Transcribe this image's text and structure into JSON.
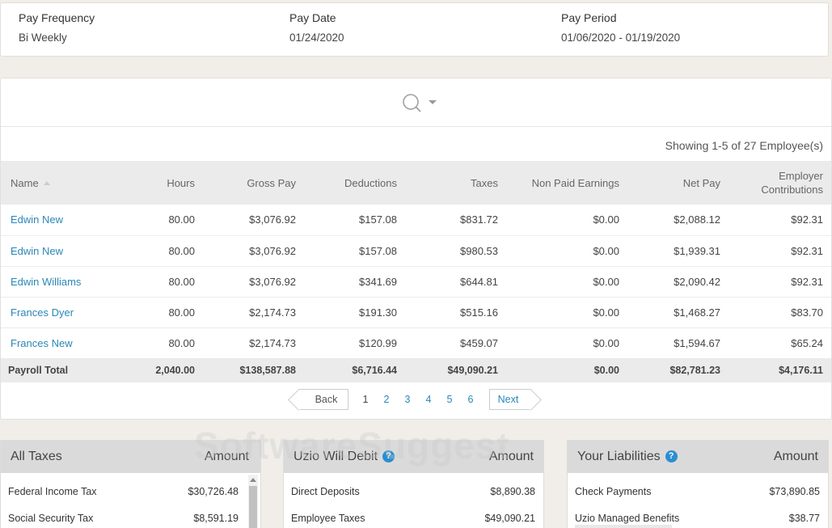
{
  "pay_info": {
    "frequency_label": "Pay Frequency",
    "frequency_value": "Bi Weekly",
    "date_label": "Pay Date",
    "date_value": "01/24/2020",
    "period_label": "Pay Period",
    "period_value": "01/06/2020 - 01/19/2020"
  },
  "search": {
    "icon": "search-icon",
    "dropdown_icon": "caret-down-icon"
  },
  "showing_text": "Showing 1-5 of 27 Employee(s)",
  "table": {
    "headers": {
      "name": "Name",
      "hours": "Hours",
      "gross": "Gross Pay",
      "deductions": "Deductions",
      "taxes": "Taxes",
      "non_paid": "Non Paid Earnings",
      "net": "Net Pay",
      "employer_line1": "Employer",
      "employer_line2": "Contributions"
    },
    "rows": [
      {
        "name": "Edwin New",
        "hours": "80.00",
        "gross": "$3,076.92",
        "deductions": "$157.08",
        "taxes": "$831.72",
        "non_paid": "$0.00",
        "net": "$2,088.12",
        "employer": "$92.31"
      },
      {
        "name": "Edwin New",
        "hours": "80.00",
        "gross": "$3,076.92",
        "deductions": "$157.08",
        "taxes": "$980.53",
        "non_paid": "$0.00",
        "net": "$1,939.31",
        "employer": "$92.31"
      },
      {
        "name": "Edwin Williams",
        "hours": "80.00",
        "gross": "$3,076.92",
        "deductions": "$341.69",
        "taxes": "$644.81",
        "non_paid": "$0.00",
        "net": "$2,090.42",
        "employer": "$92.31"
      },
      {
        "name": "Frances Dyer",
        "hours": "80.00",
        "gross": "$2,174.73",
        "deductions": "$191.30",
        "taxes": "$515.16",
        "non_paid": "$0.00",
        "net": "$1,468.27",
        "employer": "$83.70"
      },
      {
        "name": "Frances New",
        "hours": "80.00",
        "gross": "$2,174.73",
        "deductions": "$120.99",
        "taxes": "$459.07",
        "non_paid": "$0.00",
        "net": "$1,594.67",
        "employer": "$65.24"
      }
    ],
    "total": {
      "name": "Payroll Total",
      "hours": "2,040.00",
      "gross": "$138,587.88",
      "deductions": "$6,716.44",
      "taxes": "$49,090.21",
      "non_paid": "$0.00",
      "net": "$82,781.23",
      "employer": "$4,176.11"
    }
  },
  "pagination": {
    "back": "Back",
    "next": "Next",
    "pages": [
      "1",
      "2",
      "3",
      "4",
      "5",
      "6"
    ],
    "current": "1"
  },
  "panels": {
    "all_taxes": {
      "title": "All Taxes",
      "amount_label": "Amount",
      "rows": [
        {
          "label": "Federal Income Tax",
          "value": "$30,726.48"
        },
        {
          "label": "Social Security Tax",
          "value": "$8,591.19"
        }
      ]
    },
    "uzio_debit": {
      "title": "Uzio Will Debit",
      "amount_label": "Amount",
      "help_icon": "help-icon",
      "rows": [
        {
          "label": "Direct Deposits",
          "value": "$8,890.38"
        },
        {
          "label": "Employee Taxes",
          "value": "$49,090.21"
        }
      ]
    },
    "liabilities": {
      "title": "Your Liabilities",
      "amount_label": "Amount",
      "help_icon": "help-icon",
      "rows": [
        {
          "label": "Check Payments",
          "value": "$73,890.85"
        },
        {
          "label": "Uzio Managed Benefits",
          "value": "$38.77"
        }
      ]
    }
  },
  "watermark": "SoftwareSuggest",
  "colors": {
    "link": "#2a87b6",
    "help": "#2a8ed0",
    "header_bg": "#ebebeb",
    "page_bg": "#f1eeea"
  }
}
